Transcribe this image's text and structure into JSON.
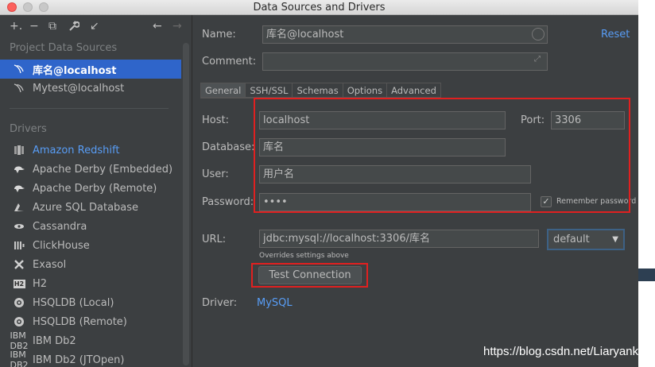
{
  "window": {
    "title": "Data Sources and Drivers"
  },
  "toolbar": {
    "add_icon": "+.",
    "remove_icon": "−",
    "duplicate_icon": "⧉",
    "settings_icon": "🔧",
    "import_icon": "↙",
    "back_icon": "←",
    "forward_icon": "→"
  },
  "sidebar": {
    "project_title": "Project Data Sources",
    "data_sources": [
      {
        "label": "库名@localhost",
        "selected": true
      },
      {
        "label": "Mytest@localhost",
        "selected": false
      }
    ],
    "drivers_title": "Drivers",
    "drivers": [
      {
        "label": "Amazon Redshift",
        "icon": "redshift-icon"
      },
      {
        "label": "Apache Derby (Embedded)",
        "icon": "derby-icon"
      },
      {
        "label": "Apache Derby (Remote)",
        "icon": "derby-icon"
      },
      {
        "label": "Azure SQL Database",
        "icon": "azure-icon"
      },
      {
        "label": "Cassandra",
        "icon": "cassandra-icon"
      },
      {
        "label": "ClickHouse",
        "icon": "clickhouse-icon"
      },
      {
        "label": "Exasol",
        "icon": "exasol-icon"
      },
      {
        "label": "H2",
        "icon": "h2-icon"
      },
      {
        "label": "HSQLDB (Local)",
        "icon": "hsqldb-icon"
      },
      {
        "label": "HSQLDB (Remote)",
        "icon": "hsqldb-icon"
      },
      {
        "label": "IBM Db2",
        "icon": "db2-icon"
      },
      {
        "label": "IBM Db2 (JTOpen)",
        "icon": "db2-icon"
      }
    ],
    "db2_badge_line1": "IBM",
    "db2_badge_line2": "DB2",
    "h2_badge": "H2"
  },
  "form": {
    "name_label": "Name:",
    "name_value": "库名@localhost",
    "reset_label": "Reset",
    "comment_label": "Comment:",
    "comment_value": "",
    "tabs": [
      "General",
      "SSH/SSL",
      "Schemas",
      "Options",
      "Advanced"
    ],
    "host_label": "Host:",
    "host_value": "localhost",
    "port_label": "Port:",
    "port_value": "3306",
    "database_label": "Database:",
    "database_value": "库名",
    "user_label": "User:",
    "user_value": "用户名",
    "password_label": "Password:",
    "password_value": "••••",
    "remember_label": "Remember password",
    "remember_checked": true,
    "url_label": "URL:",
    "url_value": "jdbc:mysql://localhost:3306/库名",
    "url_hint": "Overrides settings above",
    "url_mode": "default",
    "test_button_label": "Test Connection",
    "driver_label": "Driver:",
    "driver_value": "MySQL"
  },
  "watermark": "https://blog.csdn.net/Liaryank",
  "colors": {
    "background": "#3c3f41",
    "selection": "#2f65ca",
    "link": "#589df6",
    "highlight_box": "#e02020"
  }
}
